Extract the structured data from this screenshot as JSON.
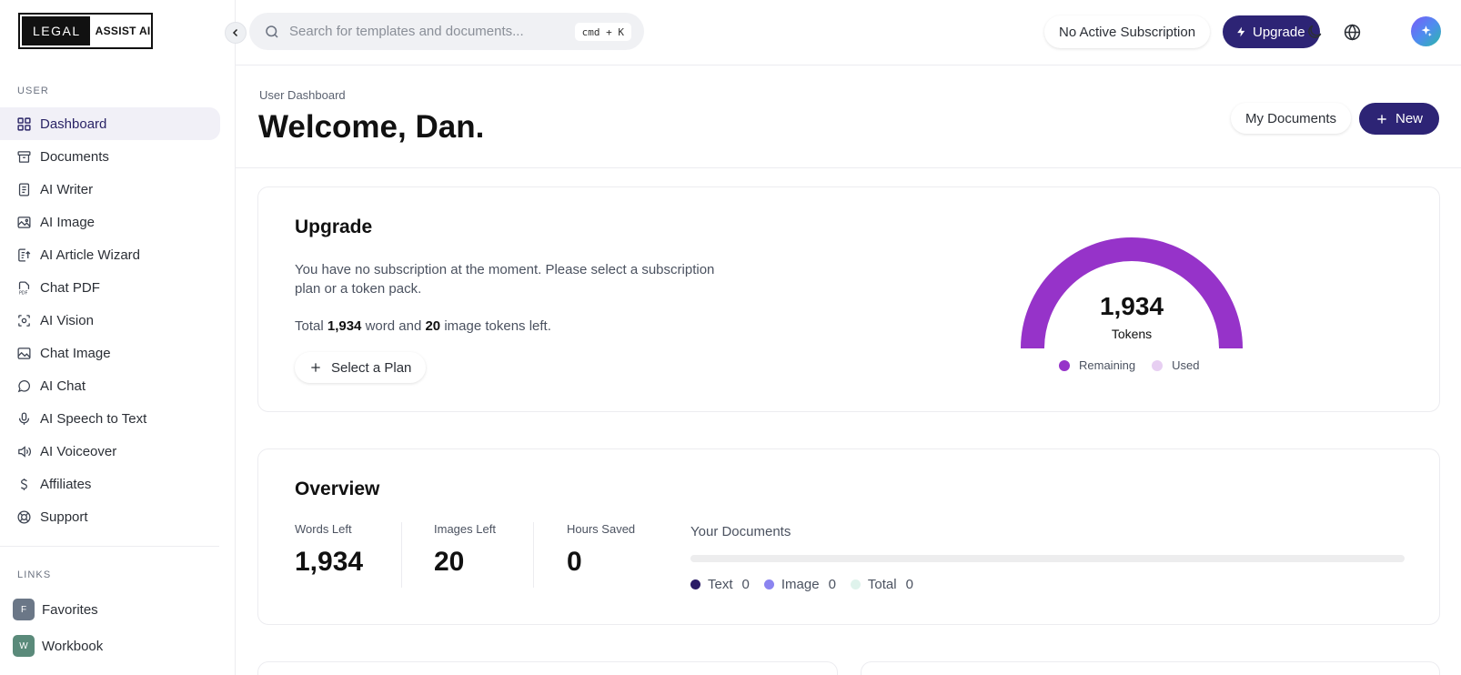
{
  "brand": {
    "left": "LEGAL",
    "right": "ASSIST AI"
  },
  "sidebar": {
    "user_section_label": "USER",
    "items": [
      {
        "label": "Dashboard",
        "icon": "dashboard-icon",
        "active": true
      },
      {
        "label": "Documents",
        "icon": "archive-icon"
      },
      {
        "label": "AI Writer",
        "icon": "document-icon"
      },
      {
        "label": "AI Image",
        "icon": "image-icon"
      },
      {
        "label": "AI Article Wizard",
        "icon": "article-icon"
      },
      {
        "label": "Chat PDF",
        "icon": "pdf-icon"
      },
      {
        "label": "AI Vision",
        "icon": "scan-icon"
      },
      {
        "label": "Chat Image",
        "icon": "image-chat-icon"
      },
      {
        "label": "AI Chat",
        "icon": "chat-bubble-icon"
      },
      {
        "label": "AI Speech to Text",
        "icon": "microphone-icon"
      },
      {
        "label": "AI Voiceover",
        "icon": "speaker-icon"
      },
      {
        "label": "Affiliates",
        "icon": "dollar-icon"
      },
      {
        "label": "Support",
        "icon": "lifebuoy-icon"
      }
    ],
    "links_section_label": "LINKS",
    "links": [
      {
        "label": "Favorites",
        "badge": "F",
        "color": "#6b7787"
      },
      {
        "label": "Workbook",
        "badge": "W",
        "color": "#5a8a7a"
      }
    ]
  },
  "topbar": {
    "search_placeholder": "Search for templates and documents...",
    "search_shortcut": "cmd + K",
    "subscription_status": "No Active Subscription",
    "upgrade_label": "Upgrade"
  },
  "header": {
    "breadcrumb": "User Dashboard",
    "title": "Welcome, Dan.",
    "my_documents_label": "My Documents",
    "new_label": "New"
  },
  "upgrade_card": {
    "title": "Upgrade",
    "description": "You have no subscription at the moment. Please select a subscription plan or a token pack.",
    "tokens_prefix": "Total",
    "words": "1,934",
    "tokens_middle": "word and",
    "images": "20",
    "tokens_suffix": "image tokens left.",
    "select_plan_label": "Select a Plan",
    "gauge": {
      "value": "1,934",
      "label": "Tokens",
      "remaining_fraction": 1.0,
      "legend_remaining": "Remaining",
      "legend_used": "Used",
      "remaining_color": "#9633c9",
      "used_color": "#e7cff2"
    }
  },
  "overview": {
    "title": "Overview",
    "stats": [
      {
        "label": "Words Left",
        "value": "1,934"
      },
      {
        "label": "Images Left",
        "value": "20"
      },
      {
        "label": "Hours Saved",
        "value": "0"
      }
    ],
    "documents_label": "Your Documents",
    "legend": [
      {
        "label": "Text",
        "value": "0",
        "color": "#2a1b66"
      },
      {
        "label": "Image",
        "value": "0",
        "color": "#8b84f0"
      },
      {
        "label": "Total",
        "value": "0",
        "color": "#dff3ec"
      }
    ]
  },
  "colors": {
    "accent": "#2d2475"
  }
}
